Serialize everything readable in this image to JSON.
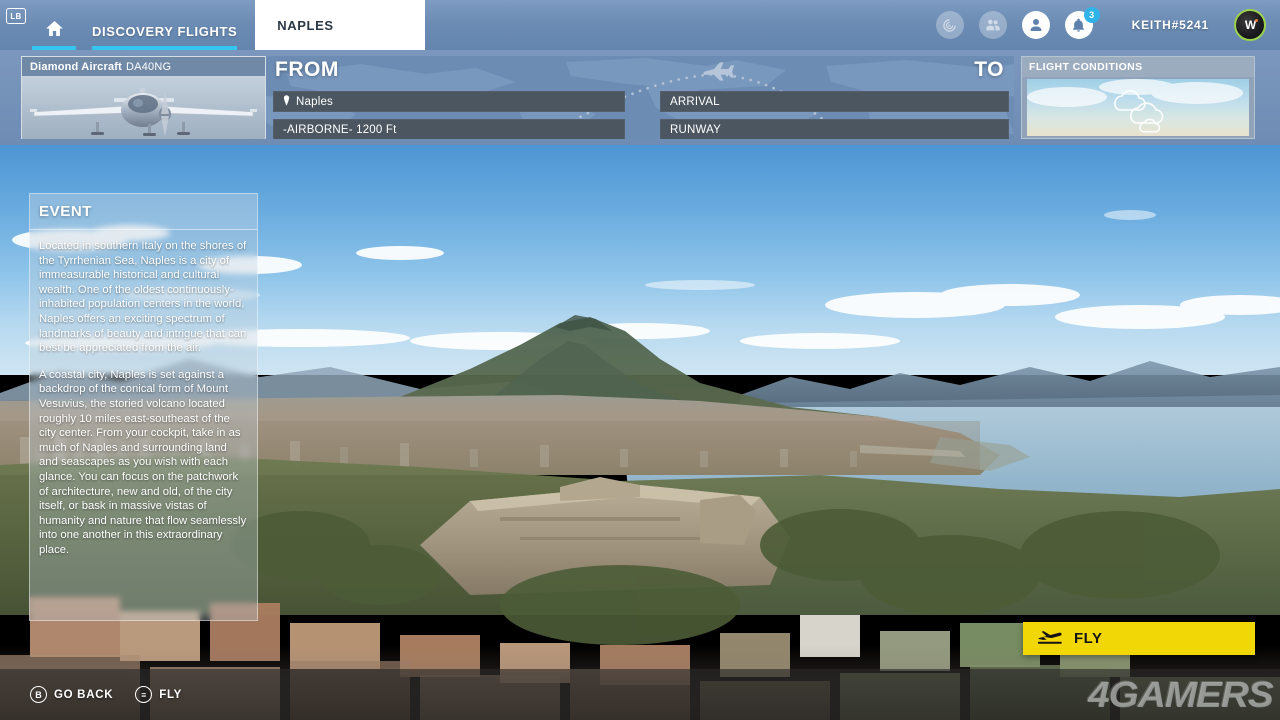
{
  "topbar": {
    "lb_badge": "LB",
    "home_icon": "home-icon",
    "tabs": [
      {
        "label": "DISCOVERY FLIGHTS",
        "active": false
      },
      {
        "label": "NAPLES",
        "active": true
      }
    ],
    "icons": [
      {
        "name": "radar-icon",
        "state": "dim"
      },
      {
        "name": "friends-icon",
        "state": "dim"
      },
      {
        "name": "profile-icon",
        "state": "solid"
      },
      {
        "name": "notifications-bell-icon",
        "state": "solid",
        "badge": "3"
      }
    ],
    "gamertag": "KEITH#5241",
    "avatar_mark": "W"
  },
  "aircraft": {
    "brand": "Diamond Aircraft",
    "model": "DA40NG"
  },
  "flightplan": {
    "from_label": "FROM",
    "to_label": "TO",
    "departure": "Naples",
    "departure_pin_icon": "location-pin-icon",
    "altitude": "-AIRBORNE- 1200 Ft",
    "arrival": "ARRIVAL",
    "runway": "RUNWAY",
    "route_plane_icon": "airplane-icon"
  },
  "conditions": {
    "title": "FLIGHT CONDITIONS",
    "weather_icon": "clouds-icon"
  },
  "event": {
    "title": "EVENT",
    "paragraphs": [
      "Located in southern Italy on the shores of the Tyrrhenian Sea, Naples is a city of immeasurable historical and cultural wealth. One of the oldest continuously-inhabited population centers in the world, Naples offers an exciting spectrum of landmarks of beauty and intrigue that can best be appreciated from the air.",
      "A coastal city, Naples is set against a backdrop of the conical form of Mount Vesuvius, the storied volcano located roughly 10 miles east-southeast of the city center. From your cockpit, take in as much of Naples and surrounding land and seascapes as you wish with each glance. You can focus on the patchwork of architecture, new and old, of the city itself, or bask in massive vistas of humanity and nature that flow seamlessly into one another in this extraordinary place."
    ]
  },
  "fly_button": {
    "label": "FLY",
    "icon": "takeoff-plane-icon",
    "color": "#f2d707"
  },
  "bottombar": {
    "hints": [
      {
        "glyph": "B",
        "label": "GO BACK",
        "icon": "b-button-icon"
      },
      {
        "glyph": "≡",
        "label": "FLY",
        "icon": "menu-button-icon"
      }
    ]
  },
  "watermark": {
    "text": "4GAMERS"
  },
  "colors": {
    "topbar": "#6c8cb4",
    "accent_cyan": "#36c4f0",
    "fly_yellow": "#f2d707",
    "field_dark": "#4b5660",
    "avatar_ring": "#9cd24b"
  }
}
